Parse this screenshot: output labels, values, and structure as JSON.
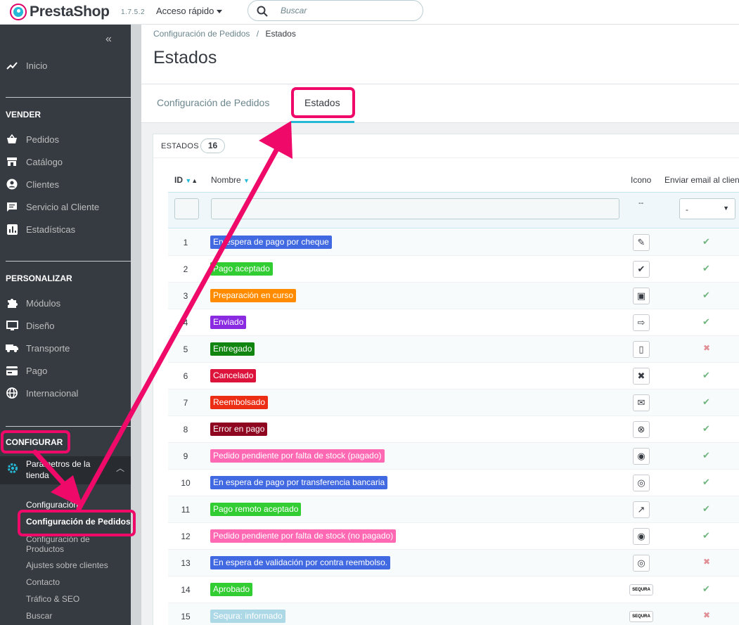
{
  "brand": {
    "name": "PrestaShop",
    "version": "1.7.5.2"
  },
  "topbar": {
    "quick_access": "Acceso rápido",
    "search_placeholder": "Buscar"
  },
  "sidebar": {
    "home": "Inicio",
    "sell_title": "VENDER",
    "sell_items": [
      "Pedidos",
      "Catálogo",
      "Clientes",
      "Servicio al Cliente",
      "Estadísticas"
    ],
    "custom_title": "PERSONALIZAR",
    "custom_items": [
      "Módulos",
      "Diseño",
      "Transporte",
      "Pago",
      "Internacional"
    ],
    "config_title": "CONFIGURAR",
    "config_parent": "Parámetros de la tienda",
    "config_subitems": [
      "Configuración",
      "Configuración de Pedidos",
      "Configuración de Productos",
      "Ajustes sobre clientes",
      "Contacto",
      "Tráfico & SEO",
      "Buscar"
    ]
  },
  "breadcrumb": {
    "parent": "Configuración de Pedidos",
    "sep": "/",
    "current": "Estados"
  },
  "page_title": "Estados",
  "tabs": [
    "Configuración de Pedidos",
    "Estados"
  ],
  "panel": {
    "title": "ESTADOS",
    "count": "16"
  },
  "table": {
    "headers": {
      "id": "ID",
      "name": "Nombre",
      "icon": "Icono",
      "email": "Enviar email al cliente"
    },
    "filter_icon_placeholder": "--",
    "filter_select": "-",
    "rows": [
      {
        "id": "1",
        "name": "En espera de pago por cheque",
        "color": "#4169e1",
        "email": true
      },
      {
        "id": "2",
        "name": "Pago aceptado",
        "color": "#32cd32",
        "email": true
      },
      {
        "id": "3",
        "name": "Preparación en curso",
        "color": "#ff8c00",
        "email": true
      },
      {
        "id": "4",
        "name": "Enviado",
        "color": "#8a2be2",
        "email": true
      },
      {
        "id": "5",
        "name": "Entregado",
        "color": "#108510",
        "email": false
      },
      {
        "id": "6",
        "name": "Cancelado",
        "color": "#dc143c",
        "email": true
      },
      {
        "id": "7",
        "name": "Reembolsado",
        "color": "#ec2e15",
        "email": true
      },
      {
        "id": "8",
        "name": "Error en pago",
        "color": "#8f0621",
        "email": true
      },
      {
        "id": "9",
        "name": "Pedido pendiente por falta de stock (pagado)",
        "color": "#ff69b4",
        "email": true
      },
      {
        "id": "10",
        "name": "En espera de pago por transferencia bancaria",
        "color": "#4169e1",
        "email": true
      },
      {
        "id": "11",
        "name": "Pago remoto aceptado",
        "color": "#32cd32",
        "email": true
      },
      {
        "id": "12",
        "name": "Pedido pendiente por falta de stock (no pagado)",
        "color": "#ff69b4",
        "email": true
      },
      {
        "id": "13",
        "name": "En espera de validación por contra reembolso.",
        "color": "#4169e1",
        "email": false
      },
      {
        "id": "14",
        "name": "Aprobado",
        "color": "#32cd32",
        "email": true
      },
      {
        "id": "15",
        "name": "Sequra: informado",
        "color": "#add8e6",
        "email": false
      }
    ],
    "icons": [
      "✎",
      "✔",
      "▣",
      "⇨",
      "▯",
      "✖",
      "✉",
      "⊗",
      "◉",
      "◎",
      "↗",
      "◉",
      "◎",
      "SEQURA",
      "SEQURA"
    ]
  }
}
